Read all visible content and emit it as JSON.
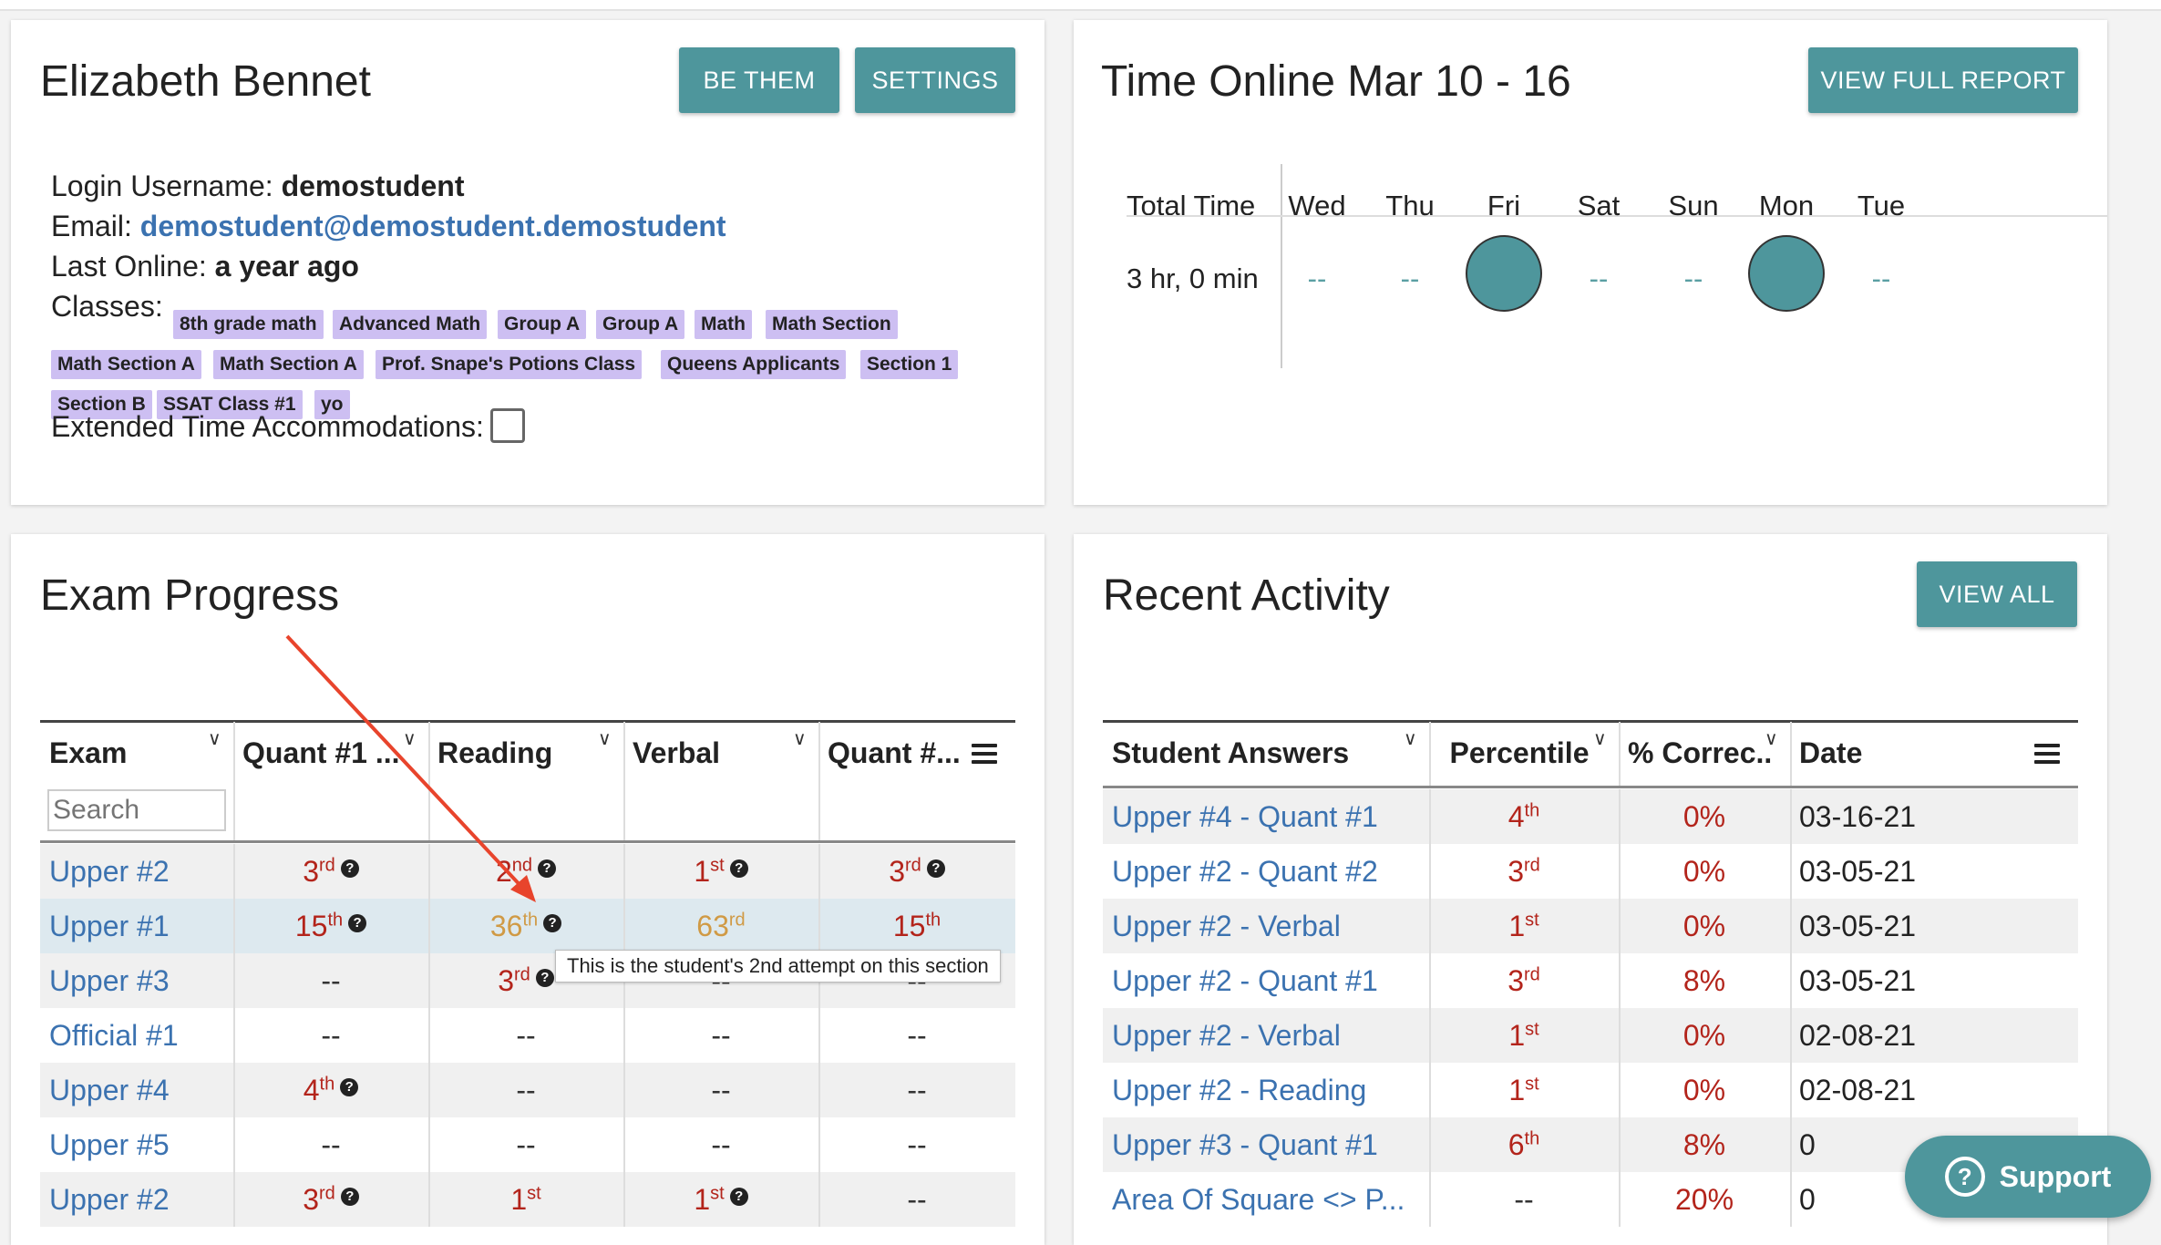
{
  "profile": {
    "name": "Elizabeth Bennet",
    "be_them": "BE THEM",
    "settings": "SETTINGS",
    "username_label": "Login Username:",
    "username": "demostudent",
    "email_label": "Email:",
    "email": "demostudent@demostudent.demostudent",
    "last_online_label": "Last Online:",
    "last_online": "a year ago",
    "classes_label": "Classes:",
    "classes": [
      "8th grade math",
      "Advanced Math",
      "Group A",
      "Group A",
      "Math",
      "Math Section",
      "Math Section A",
      "Math Section A",
      "Prof. Snape's Potions Class",
      "Queens Applicants",
      "Section 1",
      "Section B",
      "SSAT Class #1",
      "yo"
    ],
    "extended_label": "Extended Time Accommodations:"
  },
  "time_online": {
    "title": "Time Online Mar 10 - 16",
    "view_full": "VIEW FULL REPORT",
    "total_label": "Total Time",
    "days": [
      "Wed",
      "Thu",
      "Fri",
      "Sat",
      "Sun",
      "Mon",
      "Tue"
    ],
    "total": "3 hr, 0 min",
    "values": [
      "--",
      "--",
      "",
      "--",
      "--",
      "",
      "--"
    ],
    "active_days": [
      "Fri",
      "Mon"
    ]
  },
  "exam_progress": {
    "title": "Exam Progress",
    "headers": [
      "Exam",
      "Quant #1 ...",
      "Reading",
      "Verbal",
      "Quant #..."
    ],
    "search_placeholder": "Search",
    "rows": [
      {
        "exam": "Upper #2",
        "cells": [
          {
            "n": "3",
            "s": "rd",
            "c": "red",
            "q": true
          },
          {
            "n": "2",
            "s": "nd",
            "c": "red",
            "q": true
          },
          {
            "n": "1",
            "s": "st",
            "c": "red",
            "q": true
          },
          {
            "n": "3",
            "s": "rd",
            "c": "red",
            "q": true
          }
        ]
      },
      {
        "exam": "Upper #1",
        "cells": [
          {
            "n": "15",
            "s": "th",
            "c": "red",
            "q": true
          },
          {
            "n": "36",
            "s": "th",
            "c": "gold",
            "q": true
          },
          {
            "n": "63",
            "s": "rd",
            "c": "gold",
            "q": false
          },
          {
            "n": "15",
            "s": "th",
            "c": "red",
            "q": false
          }
        ]
      },
      {
        "exam": "Upper #3",
        "cells": [
          {
            "n": "--"
          },
          {
            "n": "3",
            "s": "rd",
            "c": "red",
            "q": true
          },
          {
            "n": "--"
          },
          {
            "n": "--"
          }
        ]
      },
      {
        "exam": "Official #1",
        "cells": [
          {
            "n": "--"
          },
          {
            "n": "--"
          },
          {
            "n": "--"
          },
          {
            "n": "--"
          }
        ]
      },
      {
        "exam": "Upper #4",
        "cells": [
          {
            "n": "4",
            "s": "th",
            "c": "red",
            "q": true
          },
          {
            "n": "--"
          },
          {
            "n": "--"
          },
          {
            "n": "--"
          }
        ]
      },
      {
        "exam": "Upper #5",
        "cells": [
          {
            "n": "--"
          },
          {
            "n": "--"
          },
          {
            "n": "--"
          },
          {
            "n": "--"
          }
        ]
      },
      {
        "exam": "Upper #2",
        "cells": [
          {
            "n": "3",
            "s": "rd",
            "c": "red",
            "q": true
          },
          {
            "n": "1",
            "s": "st",
            "c": "red",
            "q": false
          },
          {
            "n": "1",
            "s": "st",
            "c": "red",
            "q": true
          },
          {
            "n": "--"
          }
        ]
      }
    ],
    "tooltip": "This is the student's 2nd attempt on this section"
  },
  "recent_activity": {
    "title": "Recent Activity",
    "view_all": "VIEW ALL",
    "headers": [
      "Student Answers",
      "Percentile",
      "% Correc...",
      "Date"
    ],
    "rows": [
      {
        "name": "Upper #4 - Quant #1",
        "n": "4",
        "s": "th",
        "pct": "0%",
        "date": "03-16-21"
      },
      {
        "name": "Upper #2 - Quant #2",
        "n": "3",
        "s": "rd",
        "pct": "0%",
        "date": "03-05-21"
      },
      {
        "name": "Upper #2 - Verbal",
        "n": "1",
        "s": "st",
        "pct": "0%",
        "date": "03-05-21"
      },
      {
        "name": "Upper #2 - Quant #1",
        "n": "3",
        "s": "rd",
        "pct": "8%",
        "date": "03-05-21"
      },
      {
        "name": "Upper #2 - Verbal",
        "n": "1",
        "s": "st",
        "pct": "0%",
        "date": "02-08-21"
      },
      {
        "name": "Upper #2 - Reading",
        "n": "1",
        "s": "st",
        "pct": "0%",
        "date": "02-08-21"
      },
      {
        "name": "Upper #3 - Quant #1",
        "n": "6",
        "s": "th",
        "pct": "8%",
        "date": "0"
      },
      {
        "name": "Area Of Square <> P...",
        "n": "--",
        "s": "",
        "pct": "20%",
        "date": "0"
      }
    ]
  },
  "support": {
    "label": "Support"
  },
  "colors": {
    "accent": "#4e969c",
    "link": "#3b72b0",
    "red": "#b3241b",
    "gold": "#d09a45",
    "chip": "#cdbff2",
    "annotation_arrow": "#e8442c"
  }
}
